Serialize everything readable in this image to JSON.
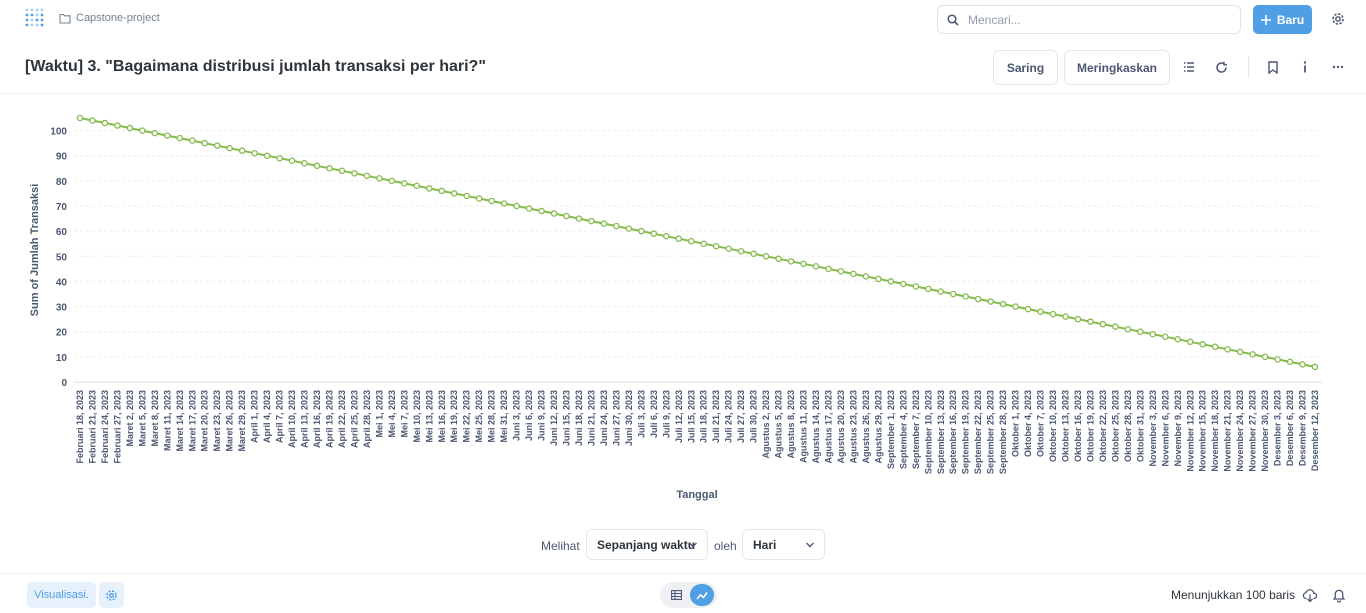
{
  "nav": {
    "logo_icon": "metabase-logo-icon",
    "breadcrumb_icon": "folder-icon",
    "collection": "Capstone-project",
    "search_placeholder": "Mencari...",
    "new_button": "Baru",
    "accent": "#509ee3"
  },
  "header": {
    "title": "[Waktu] 3. \"Bagaimana distribusi jumlah transaksi per hari?\"",
    "filter_button": "Saring",
    "summarize_button": "Meringkaskan",
    "icons": [
      "notebook-icon",
      "refresh-icon",
      "bookmark-icon",
      "info-icon",
      "more-icon"
    ]
  },
  "chart_data": {
    "type": "line",
    "xlabel": "Tanggal",
    "ylabel": "Sum of Jumlah Transaksi",
    "ylim": [
      0,
      105
    ],
    "yticks": [
      0,
      10,
      20,
      30,
      40,
      50,
      60,
      70,
      80,
      90,
      100
    ],
    "grid": true,
    "line_color": "#84bb4c",
    "categories": [
      "Februari 18, 2023",
      "Februari 21, 2023",
      "Februari 24, 2023",
      "Februari 27, 2023",
      "Maret 2, 2023",
      "Maret 5, 2023",
      "Maret 8, 2023",
      "Maret 11, 2023",
      "Maret 14, 2023",
      "Maret 17, 2023",
      "Maret 20, 2023",
      "Maret 23, 2023",
      "Maret 26, 2023",
      "Maret 29, 2023",
      "April 1, 2023",
      "April 4, 2023",
      "April 7, 2023",
      "April 10, 2023",
      "April 13, 2023",
      "April 16, 2023",
      "April 19, 2023",
      "April 22, 2023",
      "April 25, 2023",
      "April 28, 2023",
      "Mei 1, 2023",
      "Mei 4, 2023",
      "Mei 7, 2023",
      "Mei 10, 2023",
      "Mei 13, 2023",
      "Mei 16, 2023",
      "Mei 19, 2023",
      "Mei 22, 2023",
      "Mei 25, 2023",
      "Mei 28, 2023",
      "Mei 31, 2023",
      "Juni 3, 2023",
      "Juni 6, 2023",
      "Juni 9, 2023",
      "Juni 12, 2023",
      "Juni 15, 2023",
      "Juni 18, 2023",
      "Juni 21, 2023",
      "Juni 24, 2023",
      "Juni 27, 2023",
      "Juni 30, 2023",
      "Juli 3, 2023",
      "Juli 6, 2023",
      "Juli 9, 2023",
      "Juli 12, 2023",
      "Juli 15, 2023",
      "Juli 18, 2023",
      "Juli 21, 2023",
      "Juli 24, 2023",
      "Juli 27, 2023",
      "Juli 30, 2023",
      "Agustus 2, 2023",
      "Agustus 5, 2023",
      "Agustus 8, 2023",
      "Agustus 11, 2023",
      "Agustus 14, 2023",
      "Agustus 17, 2023",
      "Agustus 20, 2023",
      "Agustus 23, 2023",
      "Agustus 26, 2023",
      "Agustus 29, 2023",
      "September 1, 2023",
      "September 4, 2023",
      "September 7, 2023",
      "September 10, 2023",
      "September 13, 2023",
      "September 16, 2023",
      "September 19, 2023",
      "September 22, 2023",
      "September 25, 2023",
      "September 28, 2023",
      "Oktober 1, 2023",
      "Oktober 4, 2023",
      "Oktober 7, 2023",
      "Oktober 10, 2023",
      "Oktober 13, 2023",
      "Oktober 16, 2023",
      "Oktober 19, 2023",
      "Oktober 22, 2023",
      "Oktober 25, 2023",
      "Oktober 28, 2023",
      "Oktober 31, 2023",
      "November 3, 2023",
      "November 6, 2023",
      "November 9, 2023",
      "November 12, 2023",
      "November 15, 2023",
      "November 18, 2023",
      "November 21, 2023",
      "November 24, 2023",
      "November 27, 2023",
      "November 30, 2023",
      "Desember 3, 2023",
      "Desember 6, 2023",
      "Desember 9, 2023",
      "Desember 12, 2023"
    ],
    "series": [
      {
        "values": [
          105,
          104,
          103,
          102,
          101,
          100,
          99,
          98,
          97,
          96,
          95,
          94,
          93,
          92,
          91,
          90,
          89,
          88,
          87,
          86,
          85,
          84,
          83,
          82,
          81,
          80,
          79,
          78,
          77,
          76,
          75,
          74,
          73,
          72,
          71,
          70,
          69,
          68,
          67,
          66,
          65,
          64,
          63,
          62,
          61,
          60,
          59,
          58,
          57,
          56,
          55,
          54,
          53,
          52,
          51,
          50,
          49,
          48,
          47,
          46,
          45,
          44,
          43,
          42,
          41,
          40,
          39,
          38,
          37,
          36,
          35,
          34,
          33,
          32,
          31,
          30,
          29,
          28,
          27,
          26,
          25,
          24,
          23,
          22,
          21,
          20,
          19,
          18,
          17,
          16,
          15,
          14,
          13,
          12,
          11,
          10,
          9,
          8,
          7,
          6
        ]
      }
    ]
  },
  "controls": {
    "view_label": "Melihat",
    "range_value": "Sepanjang waktu",
    "by_label": "oleh",
    "unit_value": "Hari"
  },
  "footer": {
    "visualize_button": "Visualisasi.",
    "row_count": "Menunjukkan 100 baris",
    "icons": [
      "gear-icon",
      "table-icon",
      "line-chart-icon",
      "download-icon",
      "bell-icon"
    ]
  }
}
